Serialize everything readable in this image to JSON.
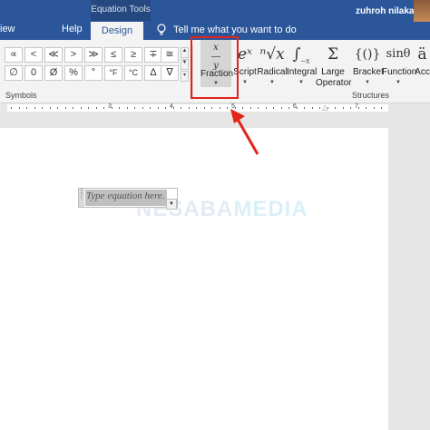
{
  "titlebar": {
    "context_group": "Equation Tools",
    "tabs": [
      "iew",
      "Help"
    ],
    "active_tab": "Design",
    "tell_me": "Tell me what you want to do",
    "user_name": "zuhroh nilakandi"
  },
  "symbols": {
    "row1": [
      "∝",
      "<",
      "≪",
      ">",
      "≫",
      "≤",
      "≥",
      "∓",
      "≅",
      "≈"
    ],
    "row2": [
      "∅",
      "0",
      "Ø",
      "%",
      "°",
      "°F",
      "°C",
      "∆",
      "∇",
      "∃"
    ],
    "label": "Symbols"
  },
  "structures": {
    "label": "Structures",
    "items": [
      {
        "label": "Fraction",
        "icon": "x/y"
      },
      {
        "label": "Script",
        "icon": "eˣ"
      },
      {
        "label": "Radical",
        "icon": "ⁿ√x"
      },
      {
        "label": "Integral",
        "icon": "∫"
      },
      {
        "label": "Large Operator",
        "icon": "Σ"
      },
      {
        "label": "Bracket",
        "icon": "{()}"
      },
      {
        "label": "Function",
        "icon": "sinθ"
      },
      {
        "label": "Acc",
        "icon": "ä"
      }
    ]
  },
  "ruler": {
    "numbers": [
      "3",
      "4",
      "5",
      "6",
      "7"
    ]
  },
  "equation": {
    "placeholder": "Type equation here."
  },
  "watermark": {
    "part1": "NESABA",
    "part2": "MEDIA"
  },
  "colors": {
    "accent": "#2b579a",
    "highlight": "#e2231a"
  }
}
